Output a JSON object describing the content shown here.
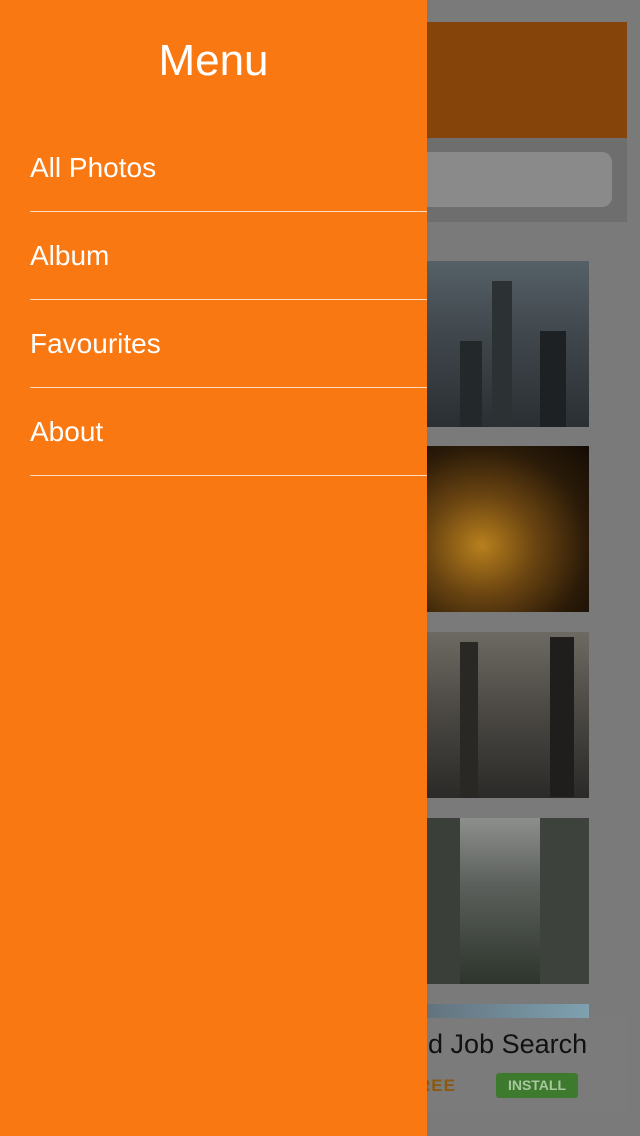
{
  "menu": {
    "title": "Menu",
    "items": [
      {
        "label": "All Photos"
      },
      {
        "label": "Album"
      },
      {
        "label": "Favourites"
      },
      {
        "label": "About"
      }
    ]
  },
  "background": {
    "ad": {
      "title": "eed Job Search",
      "free_label": "REE",
      "install_label": "INSTALL"
    }
  },
  "colors": {
    "drawer": "#fa7811",
    "header_dimmed": "#85440a",
    "install_green": "#3d7a2d"
  }
}
